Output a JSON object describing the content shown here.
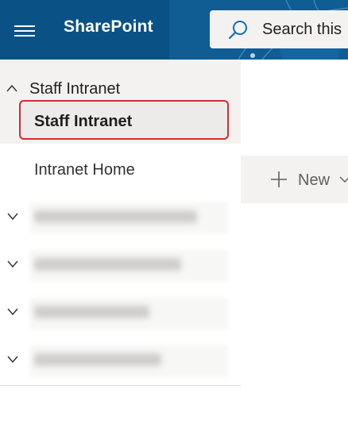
{
  "header": {
    "brand": "SharePoint",
    "search_placeholder": "Search this",
    "colors": {
      "bar": "#0f5d93",
      "app_section": "#0a5285"
    }
  },
  "nav": {
    "group_title": "Staff Intranet",
    "items": [
      {
        "label": "Staff Intranet",
        "selected": true
      },
      {
        "label": "Intranet Home",
        "selected": false
      }
    ],
    "collapsed_groups_count_visible": 4
  },
  "commandbar": {
    "new_label": "New"
  },
  "icons": {
    "menu": "hamburger-icon",
    "search": "search-icon",
    "expand": "chevron-up-icon",
    "collapse": "chevron-down-icon",
    "add": "plus-icon"
  },
  "accent": {
    "selection_border": "#d9282f"
  }
}
